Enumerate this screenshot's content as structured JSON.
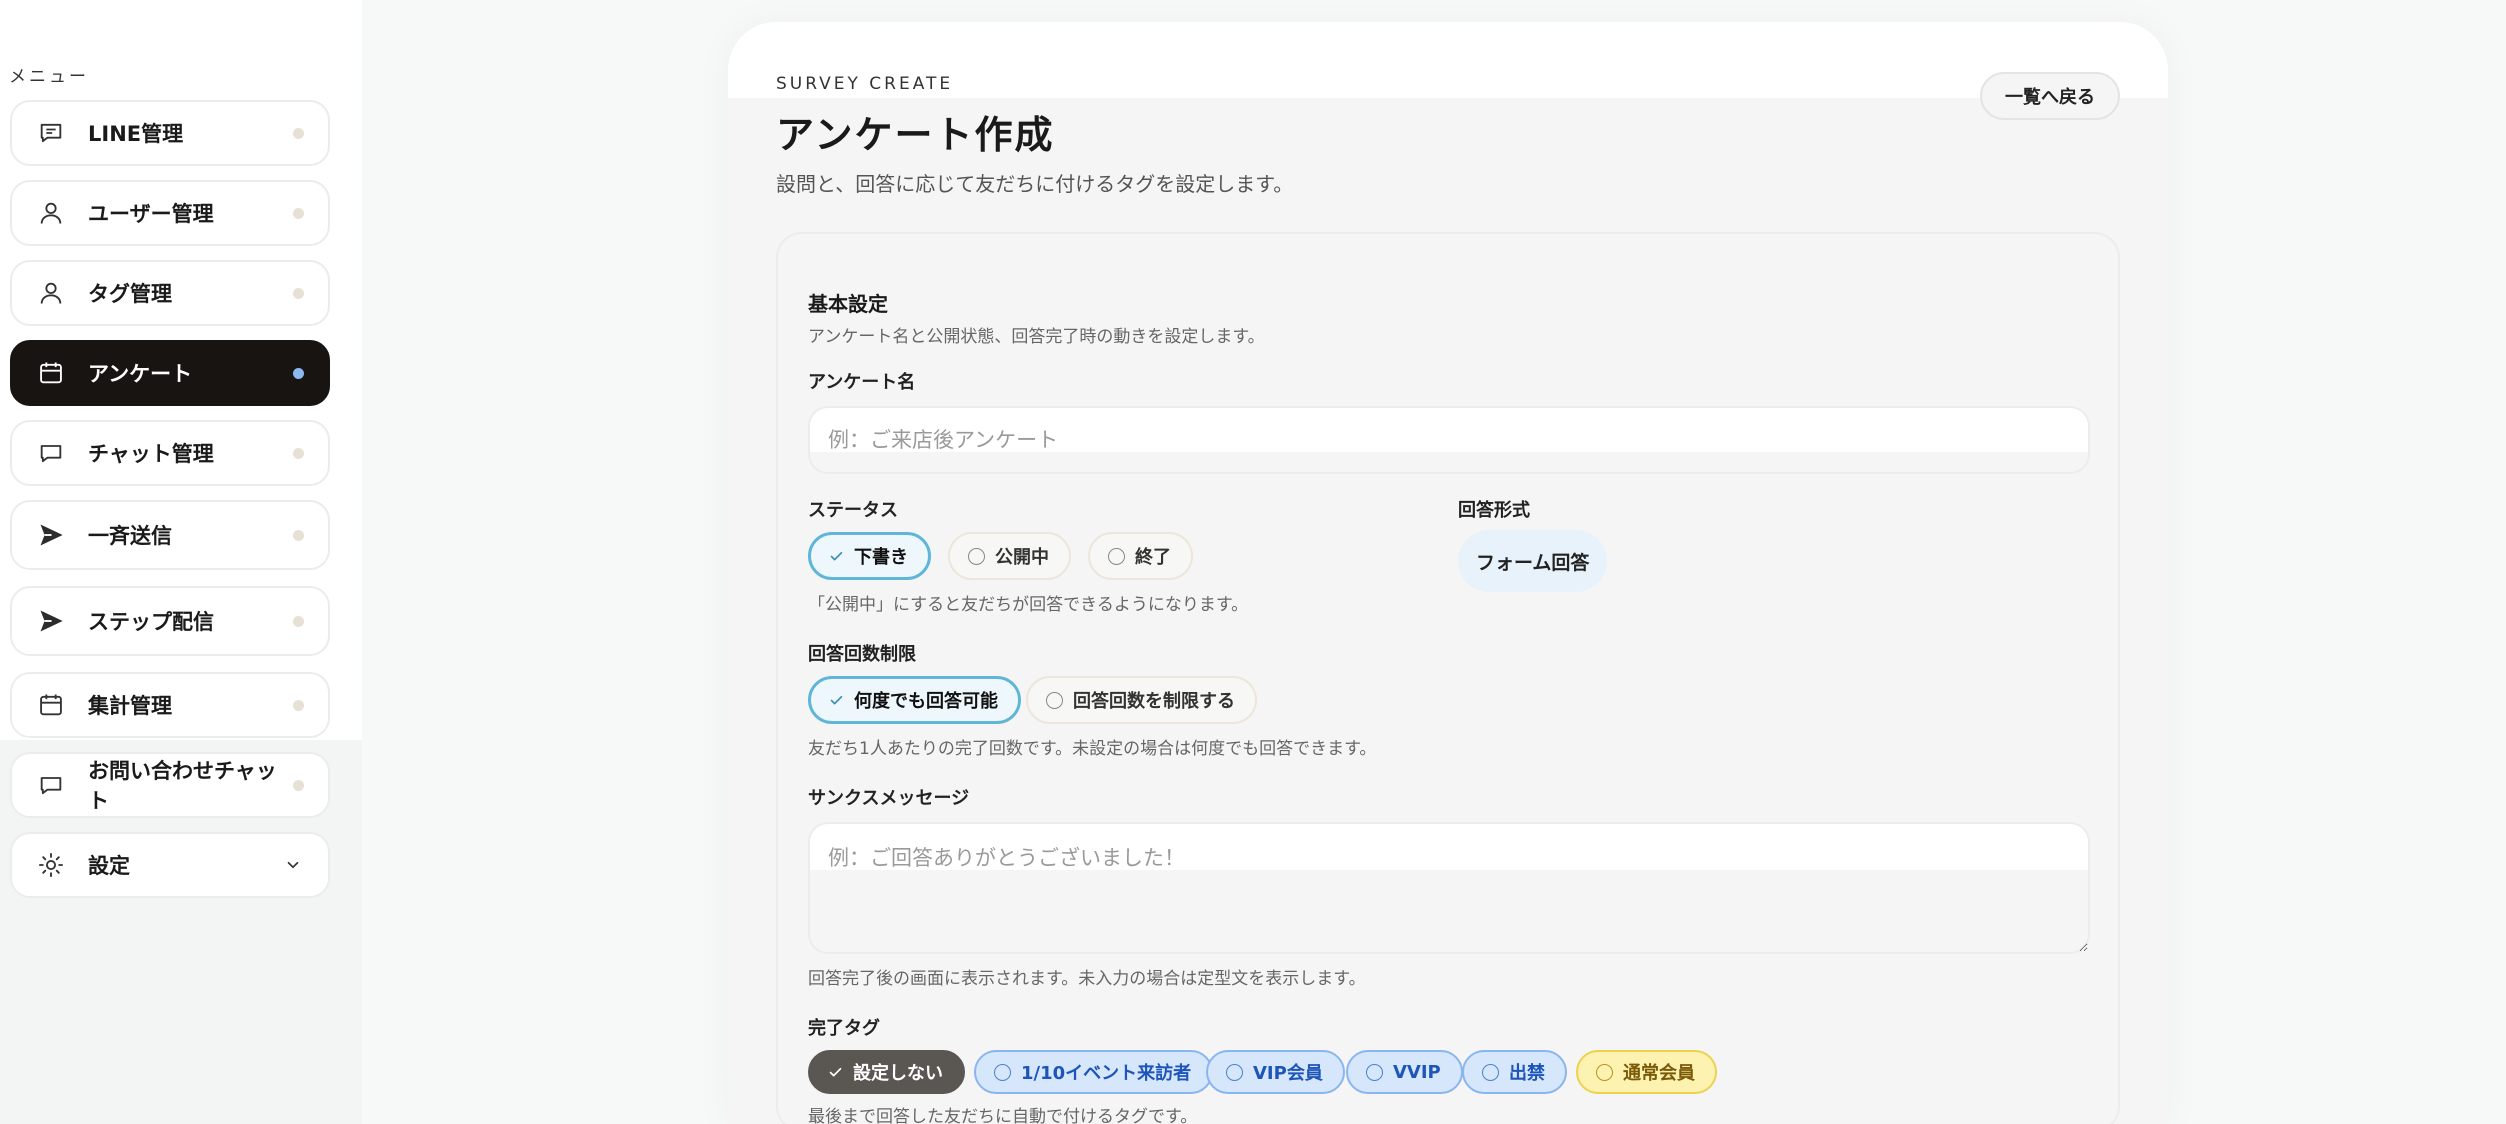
{
  "sidebar": {
    "caption": "メニュー",
    "items": [
      {
        "label": "LINE管理",
        "icon": "chat-bubble-lines-icon"
      },
      {
        "label": "ユーザー管理",
        "icon": "user-icon"
      },
      {
        "label": "タグ管理",
        "icon": "user-icon"
      },
      {
        "label": "アンケート",
        "icon": "calendar-icon",
        "active": true
      },
      {
        "label": "チャット管理",
        "icon": "chat-bubble-icon"
      },
      {
        "label": "一斉送信",
        "icon": "send-icon"
      },
      {
        "label": "ステップ配信",
        "icon": "send-icon"
      },
      {
        "label": "集計管理",
        "icon": "calendar-icon"
      },
      {
        "label": "お問い合わせチャット",
        "icon": "chat-bubble-icon"
      },
      {
        "label": "設定",
        "icon": "gear-icon",
        "expandable": true
      }
    ]
  },
  "header": {
    "eyebrow": "SURVEY CREATE",
    "title": "アンケート作成",
    "description": "設問と、回答に応じて友だちに付けるタグを設定します。",
    "back_label": "一覧へ戻る"
  },
  "basic": {
    "title": "基本設定",
    "description": "アンケート名と公開状態、回答完了時の動きを設定します。",
    "name_label": "アンケート名",
    "name_placeholder": "例：ご来店後アンケート",
    "status_label": "ステータス",
    "status_options": [
      {
        "label": "下書き",
        "selected": true
      },
      {
        "label": "公開中",
        "selected": false
      },
      {
        "label": "終了",
        "selected": false
      }
    ],
    "status_hint": "「公開中」にすると友だちが回答できるようになります。",
    "format_label": "回答形式",
    "format_value": "フォーム回答",
    "limit_label": "回答回数制限",
    "limit_options": [
      {
        "label": "何度でも回答可能",
        "selected": true
      },
      {
        "label": "回答回数を制限する",
        "selected": false
      }
    ],
    "limit_hint": "友だち1人あたりの完了回数です。未設定の場合は何度でも回答できます。",
    "thanks_label": "サンクスメッセージ",
    "thanks_placeholder": "例：ご回答ありがとうございました！",
    "thanks_hint": "回答完了後の画面に表示されます。未入力の場合は定型文を表示します。",
    "tag_label": "完了タグ",
    "tag_options": [
      {
        "label": "設定しない",
        "selected": true,
        "color": "#5a5652"
      },
      {
        "label": "1/10イベント来訪者",
        "selected": false,
        "color": "#d6e6fb"
      },
      {
        "label": "VIP会員",
        "selected": false,
        "color": "#d6e6fb"
      },
      {
        "label": "VVIP",
        "selected": false,
        "color": "#d6e6fb"
      },
      {
        "label": "出禁",
        "selected": false,
        "color": "#d6e6fb"
      },
      {
        "label": "通常会員",
        "selected": false,
        "color": "#fdf2b0"
      }
    ],
    "tag_hint": "最後まで回答した友だちに自動で付けるタグです。"
  },
  "colors": {
    "active_nav": "#171411",
    "active_dot": "#8cb8f2",
    "selected_chip_border": "#5fb6d6"
  }
}
